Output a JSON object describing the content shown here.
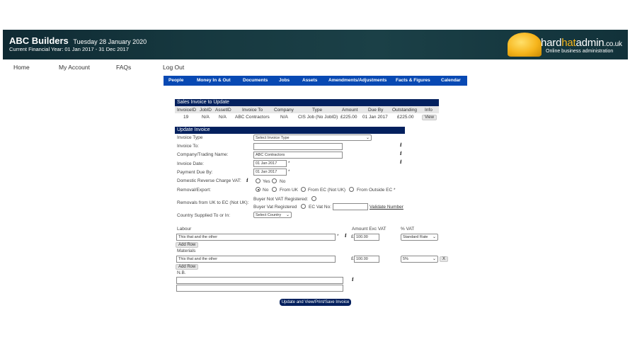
{
  "header": {
    "company": "ABC Builders",
    "date": "Tuesday 28 January 2020",
    "financial_year": "Current Financial Year: 01 Jan 2017 - 31 Dec 2017",
    "logo_part1": "hard",
    "logo_part2": "hat",
    "logo_part3": "admin",
    "logo_part4": ".co.uk",
    "logo_tagline": "Online business administration"
  },
  "topnav": [
    "Home",
    "My Account",
    "FAQs",
    "Log Out"
  ],
  "menu": [
    "People",
    "Money In & Out",
    "Documents",
    "Jobs",
    "Assets",
    "Amendments/Adjustments",
    "Facts & Figures",
    "Calendar"
  ],
  "summary": {
    "title": "Sales Invoice to Update",
    "headers": [
      "InvoiceID",
      "JobID",
      "AssetID",
      "Invoice To",
      "Company",
      "Type",
      "Amount",
      "Due By",
      "Outstanding",
      "Info"
    ],
    "row": [
      "19",
      "N/A",
      "N/A",
      "ABC Contractors",
      "N/A",
      "CIS Job (No JobID)",
      "£225.00",
      "01 Jan 2017",
      "£225.00"
    ],
    "view_label": "View"
  },
  "form": {
    "title": "Update Invoice",
    "invoice_type_label": "Invoice Type",
    "invoice_type_value": "Select Invoice Type",
    "invoice_to_label": "Invoice To:",
    "invoice_to_value": "",
    "company_label": "Company/Trading Name:",
    "company_value": "ABC Contractors",
    "invoice_date_label": "Invoice Date:",
    "invoice_date_value": "01 Jan 2017",
    "payment_due_label": "Payment Due By:",
    "payment_due_value": "01 Jan 2017",
    "reverse_vat_label": "Domestic Reverse Charge VAT:",
    "yes": "Yes",
    "no": "No",
    "removal_label": "Removal/Export:",
    "removal_no": "No",
    "from_uk": "From UK",
    "from_ec": "From EC (Not UK)",
    "from_outside": "From Outside EC",
    "removals_uk_ec_label": "Removals from UK to EC (Not UK):",
    "buyer_not_vat": "Buyer Not VAT Registered:",
    "buyer_vat": "Buyer Vat Registered",
    "ec_vat_no": "EC Vat No:",
    "ec_vat_value": "",
    "validate": "Validate Number",
    "country_label": "Country Supplied To or In:",
    "country_value": "Select Country",
    "labour_label": "Labour",
    "amount_label": "Amount Exc VAT",
    "vat_label": "% VAT",
    "labour_desc": "This that and the other",
    "currency": "£",
    "labour_amount": "100.00",
    "labour_vat": "Standard Rate",
    "add_row": "Add Row",
    "materials_label": "Materials",
    "materials_desc": "This that and the other",
    "materials_amount": "100.00",
    "materials_vat": "5%",
    "remove": "X",
    "nb_label": "N.B.",
    "submit": "Update and View/Print/Save Invoice"
  },
  "star": "*",
  "info": "i",
  "caret": "⌄"
}
